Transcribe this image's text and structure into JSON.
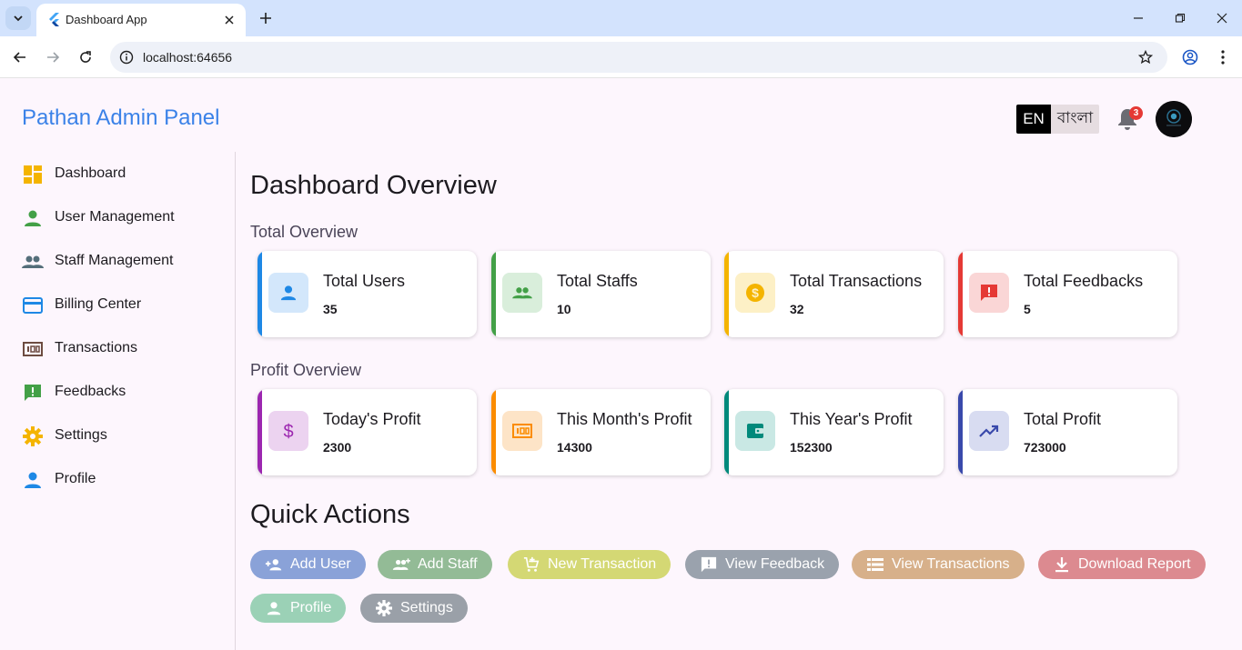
{
  "browser": {
    "tab_title": "Dashboard App",
    "url": "localhost:64656"
  },
  "header": {
    "brand": "Pathan Admin Panel",
    "lang_en": "EN",
    "lang_bn": "বাংলা",
    "notification_count": "3"
  },
  "sidebar": {
    "items": [
      {
        "label": "Dashboard",
        "icon": "dashboard-icon",
        "color": "#f4b400"
      },
      {
        "label": "User Management",
        "icon": "person-icon",
        "color": "#43a047"
      },
      {
        "label": "Staff Management",
        "icon": "people-icon",
        "color": "#546e7a"
      },
      {
        "label": "Billing Center",
        "icon": "credit-card-icon",
        "color": "#1e88e5"
      },
      {
        "label": "Transactions",
        "icon": "money-icon",
        "color": "#6d4c41"
      },
      {
        "label": "Feedbacks",
        "icon": "feedback-icon",
        "color": "#43a047"
      },
      {
        "label": "Settings",
        "icon": "gear-icon",
        "color": "#f4b400"
      },
      {
        "label": "Profile",
        "icon": "person-icon",
        "color": "#1e88e5"
      }
    ]
  },
  "main": {
    "title": "Dashboard Overview",
    "total_overview_title": "Total Overview",
    "profit_overview_title": "Profit Overview",
    "total_cards": [
      {
        "title": "Total Users",
        "value": "35",
        "icon": "person-icon",
        "color": "#1e88e5",
        "bg": "#d3e7fb"
      },
      {
        "title": "Total Staffs",
        "value": "10",
        "icon": "people-icon",
        "color": "#43a047",
        "bg": "#d9eedb"
      },
      {
        "title": "Total Transactions",
        "value": "32",
        "icon": "dollar-coin-icon",
        "color": "#f4b400",
        "bg": "#fdf0c6"
      },
      {
        "title": "Total Feedbacks",
        "value": "5",
        "icon": "feedback-icon",
        "color": "#e53935",
        "bg": "#fad6d6"
      }
    ],
    "profit_cards": [
      {
        "title": "Today's Profit",
        "value": "2300",
        "icon": "dollar-icon",
        "color": "#9c27b0",
        "bg": "#ecd3f0"
      },
      {
        "title": "This Month's Profit",
        "value": "14300",
        "icon": "money-icon",
        "color": "#fb8c00",
        "bg": "#fde4c7"
      },
      {
        "title": "This Year's Profit",
        "value": "152300",
        "icon": "wallet-icon",
        "color": "#00897b",
        "bg": "#c9e8e4"
      },
      {
        "title": "Total Profit",
        "value": "723000",
        "icon": "trending-up-icon",
        "color": "#3949ab",
        "bg": "#d8dcf1"
      }
    ],
    "quick_actions_title": "Quick Actions",
    "quick_actions": [
      {
        "label": "Add User",
        "icon": "add-person-icon",
        "color": "#8aa2d8"
      },
      {
        "label": "Add Staff",
        "icon": "add-group-icon",
        "color": "#93bb96"
      },
      {
        "label": "New Transaction",
        "icon": "add-cart-icon",
        "color": "#d4d874"
      },
      {
        "label": "View Feedback",
        "icon": "feedback-icon",
        "color": "#9aa2ad"
      },
      {
        "label": "View Transactions",
        "icon": "list-icon",
        "color": "#d7b08a"
      },
      {
        "label": "Download Report",
        "icon": "download-icon",
        "color": "#dc8a90"
      },
      {
        "label": "Profile",
        "icon": "person-icon",
        "color": "#9bd1b6"
      },
      {
        "label": "Settings",
        "icon": "gear-icon",
        "color": "#9aa0a8"
      }
    ]
  }
}
